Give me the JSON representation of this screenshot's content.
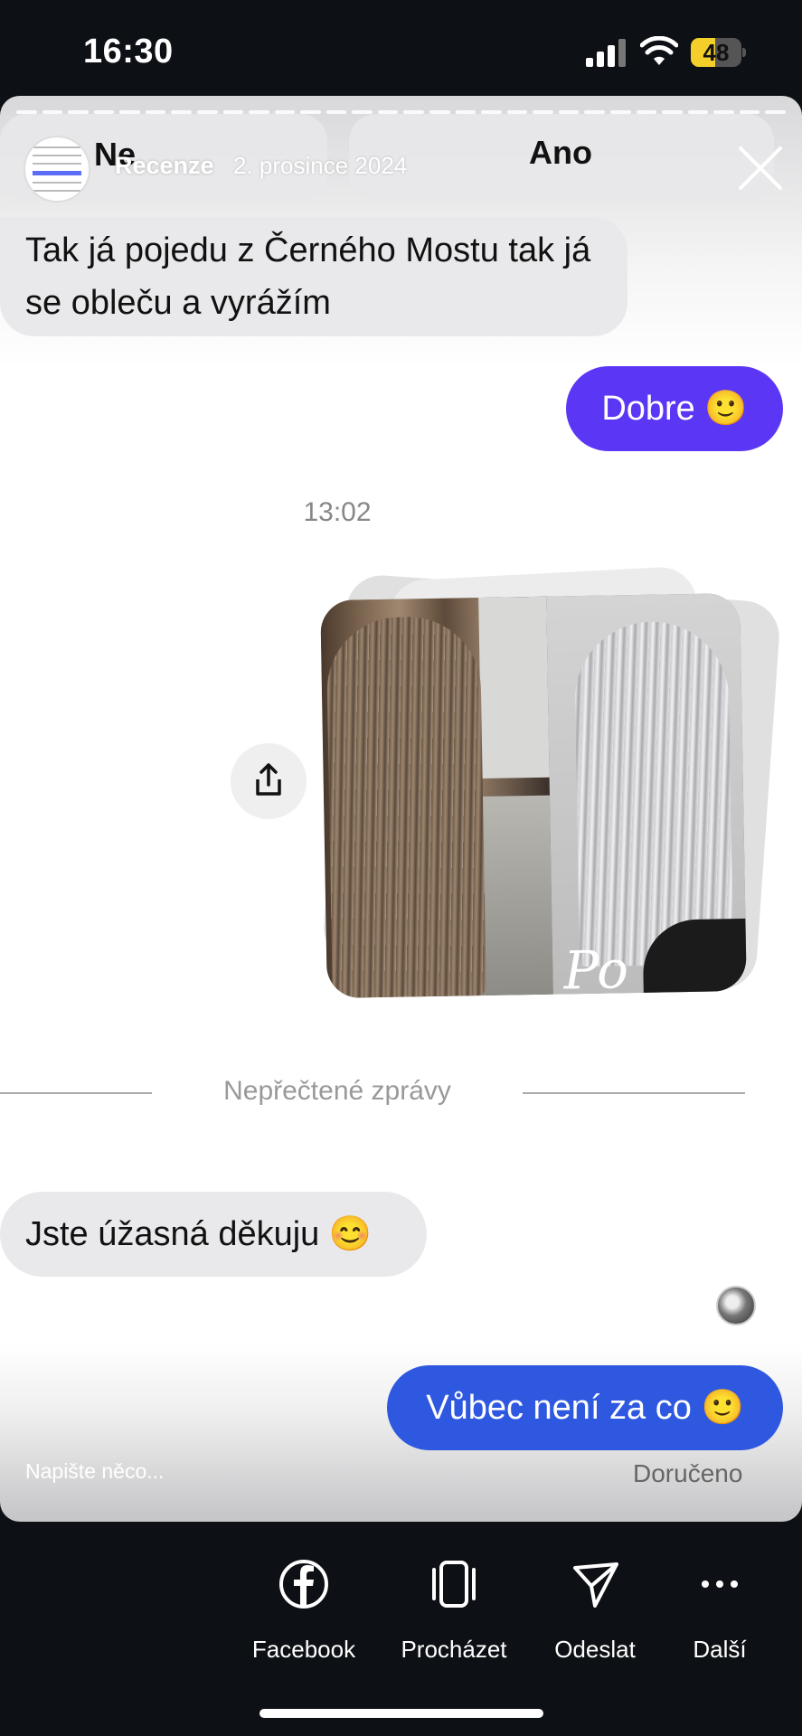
{
  "status_bar": {
    "time": "16:30",
    "battery": "48",
    "battery_level": 0.48
  },
  "story": {
    "poll": {
      "no_label": "Ne",
      "yes_label": "Ano"
    },
    "title": "Recenze",
    "date": "2. prosince 2024"
  },
  "chat": {
    "msg1": "Tak já pojedu z Černého Mostu tak já se obleču a vyrážím",
    "msg2": "Dobre 🙂",
    "timestamp": "13:02",
    "photo_caption": "Po",
    "unread_divider": "Nepřečtené zprávy",
    "msg3": "Jste úžasná děkuju 😊",
    "msg4": "Vůbec není za co 🙂",
    "compose_placeholder": "Napište něco...",
    "delivery_status": "Doručeno"
  },
  "actions": {
    "facebook": "Facebook",
    "browse": "Procházet",
    "send": "Odeslat",
    "more": "Další"
  },
  "colors": {
    "outgoing_purple": "#5b37f5",
    "outgoing_blue": "#2e58df",
    "incoming_bubble": "#e9e9eb",
    "battery_yellow": "#f4cf2a"
  }
}
